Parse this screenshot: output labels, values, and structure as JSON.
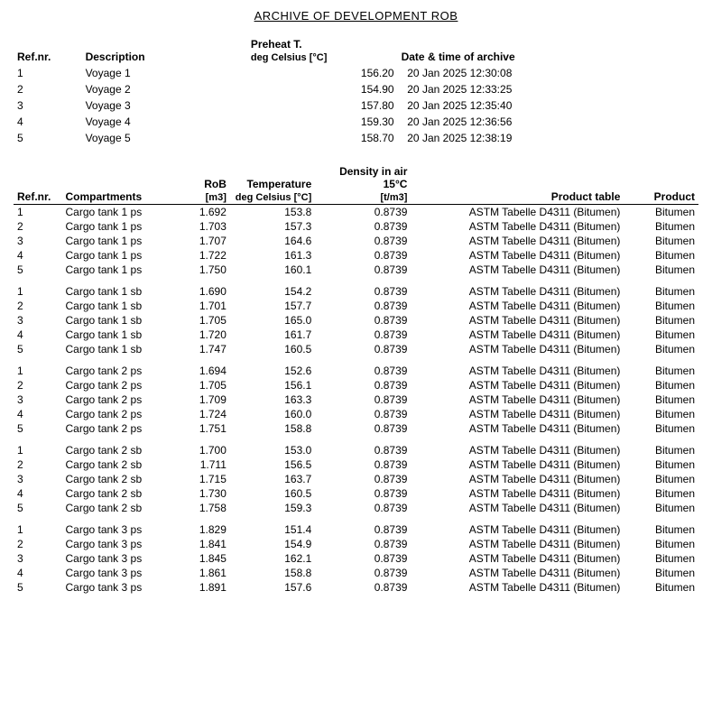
{
  "title": "ARCHIVE OF DEVELOPMENT ROB",
  "summary": {
    "headers": {
      "refnr": "Ref.nr.",
      "description": "Description",
      "preheat": "Preheat T.",
      "preheat_sub": "deg Celsius [°C]",
      "datetime": "Date & time of archive"
    },
    "rows": [
      {
        "ref": "1",
        "desc": "Voyage 1",
        "preheat": "156.20",
        "datetime": "20 Jan 2025  12:30:08"
      },
      {
        "ref": "2",
        "desc": "Voyage 2",
        "preheat": "154.90",
        "datetime": "20 Jan 2025  12:33:25"
      },
      {
        "ref": "3",
        "desc": "Voyage 3",
        "preheat": "157.80",
        "datetime": "20 Jan 2025  12:35:40"
      },
      {
        "ref": "4",
        "desc": "Voyage 4",
        "preheat": "159.30",
        "datetime": "20 Jan 2025  12:36:56"
      },
      {
        "ref": "5",
        "desc": "Voyage 5",
        "preheat": "158.70",
        "datetime": "20 Jan 2025  12:38:19"
      }
    ]
  },
  "detail": {
    "headers": {
      "refnr": "Ref.nr.",
      "compartments": "Compartments",
      "rob": "RoB",
      "rob_sub": "[m3]",
      "temperature": "Temperature",
      "temperature_sub": "deg Celsius [°C]",
      "density": "Density in air 15°C",
      "density_sub": "[t/m3]",
      "product_table": "Product table",
      "product": "Product"
    },
    "groups": [
      {
        "rows": [
          {
            "ref": "1",
            "comp": "Cargo tank 1 ps",
            "rob": "1.692",
            "temp": "153.8",
            "dens": "0.8739",
            "prod_table": "ASTM Tabelle D4311 (Bitumen)",
            "product": "Bitumen"
          },
          {
            "ref": "2",
            "comp": "Cargo tank 1 ps",
            "rob": "1.703",
            "temp": "157.3",
            "dens": "0.8739",
            "prod_table": "ASTM Tabelle D4311 (Bitumen)",
            "product": "Bitumen"
          },
          {
            "ref": "3",
            "comp": "Cargo tank 1 ps",
            "rob": "1.707",
            "temp": "164.6",
            "dens": "0.8739",
            "prod_table": "ASTM Tabelle D4311 (Bitumen)",
            "product": "Bitumen"
          },
          {
            "ref": "4",
            "comp": "Cargo tank 1 ps",
            "rob": "1.722",
            "temp": "161.3",
            "dens": "0.8739",
            "prod_table": "ASTM Tabelle D4311 (Bitumen)",
            "product": "Bitumen"
          },
          {
            "ref": "5",
            "comp": "Cargo tank 1 ps",
            "rob": "1.750",
            "temp": "160.1",
            "dens": "0.8739",
            "prod_table": "ASTM Tabelle D4311 (Bitumen)",
            "product": "Bitumen"
          }
        ]
      },
      {
        "rows": [
          {
            "ref": "1",
            "comp": "Cargo tank 1 sb",
            "rob": "1.690",
            "temp": "154.2",
            "dens": "0.8739",
            "prod_table": "ASTM Tabelle D4311 (Bitumen)",
            "product": "Bitumen"
          },
          {
            "ref": "2",
            "comp": "Cargo tank 1 sb",
            "rob": "1.701",
            "temp": "157.7",
            "dens": "0.8739",
            "prod_table": "ASTM Tabelle D4311 (Bitumen)",
            "product": "Bitumen"
          },
          {
            "ref": "3",
            "comp": "Cargo tank 1 sb",
            "rob": "1.705",
            "temp": "165.0",
            "dens": "0.8739",
            "prod_table": "ASTM Tabelle D4311 (Bitumen)",
            "product": "Bitumen"
          },
          {
            "ref": "4",
            "comp": "Cargo tank 1 sb",
            "rob": "1.720",
            "temp": "161.7",
            "dens": "0.8739",
            "prod_table": "ASTM Tabelle D4311 (Bitumen)",
            "product": "Bitumen"
          },
          {
            "ref": "5",
            "comp": "Cargo tank 1 sb",
            "rob": "1.747",
            "temp": "160.5",
            "dens": "0.8739",
            "prod_table": "ASTM Tabelle D4311 (Bitumen)",
            "product": "Bitumen"
          }
        ]
      },
      {
        "rows": [
          {
            "ref": "1",
            "comp": "Cargo tank 2 ps",
            "rob": "1.694",
            "temp": "152.6",
            "dens": "0.8739",
            "prod_table": "ASTM Tabelle D4311 (Bitumen)",
            "product": "Bitumen"
          },
          {
            "ref": "2",
            "comp": "Cargo tank 2 ps",
            "rob": "1.705",
            "temp": "156.1",
            "dens": "0.8739",
            "prod_table": "ASTM Tabelle D4311 (Bitumen)",
            "product": "Bitumen"
          },
          {
            "ref": "3",
            "comp": "Cargo tank 2 ps",
            "rob": "1.709",
            "temp": "163.3",
            "dens": "0.8739",
            "prod_table": "ASTM Tabelle D4311 (Bitumen)",
            "product": "Bitumen"
          },
          {
            "ref": "4",
            "comp": "Cargo tank 2 ps",
            "rob": "1.724",
            "temp": "160.0",
            "dens": "0.8739",
            "prod_table": "ASTM Tabelle D4311 (Bitumen)",
            "product": "Bitumen"
          },
          {
            "ref": "5",
            "comp": "Cargo tank 2 ps",
            "rob": "1.751",
            "temp": "158.8",
            "dens": "0.8739",
            "prod_table": "ASTM Tabelle D4311 (Bitumen)",
            "product": "Bitumen"
          }
        ]
      },
      {
        "rows": [
          {
            "ref": "1",
            "comp": "Cargo tank 2 sb",
            "rob": "1.700",
            "temp": "153.0",
            "dens": "0.8739",
            "prod_table": "ASTM Tabelle D4311 (Bitumen)",
            "product": "Bitumen"
          },
          {
            "ref": "2",
            "comp": "Cargo tank 2 sb",
            "rob": "1.711",
            "temp": "156.5",
            "dens": "0.8739",
            "prod_table": "ASTM Tabelle D4311 (Bitumen)",
            "product": "Bitumen"
          },
          {
            "ref": "3",
            "comp": "Cargo tank 2 sb",
            "rob": "1.715",
            "temp": "163.7",
            "dens": "0.8739",
            "prod_table": "ASTM Tabelle D4311 (Bitumen)",
            "product": "Bitumen"
          },
          {
            "ref": "4",
            "comp": "Cargo tank 2 sb",
            "rob": "1.730",
            "temp": "160.5",
            "dens": "0.8739",
            "prod_table": "ASTM Tabelle D4311 (Bitumen)",
            "product": "Bitumen"
          },
          {
            "ref": "5",
            "comp": "Cargo tank 2 sb",
            "rob": "1.758",
            "temp": "159.3",
            "dens": "0.8739",
            "prod_table": "ASTM Tabelle D4311 (Bitumen)",
            "product": "Bitumen"
          }
        ]
      },
      {
        "rows": [
          {
            "ref": "1",
            "comp": "Cargo tank 3 ps",
            "rob": "1.829",
            "temp": "151.4",
            "dens": "0.8739",
            "prod_table": "ASTM Tabelle D4311 (Bitumen)",
            "product": "Bitumen"
          },
          {
            "ref": "2",
            "comp": "Cargo tank 3 ps",
            "rob": "1.841",
            "temp": "154.9",
            "dens": "0.8739",
            "prod_table": "ASTM Tabelle D4311 (Bitumen)",
            "product": "Bitumen"
          },
          {
            "ref": "3",
            "comp": "Cargo tank 3 ps",
            "rob": "1.845",
            "temp": "162.1",
            "dens": "0.8739",
            "prod_table": "ASTM Tabelle D4311 (Bitumen)",
            "product": "Bitumen"
          },
          {
            "ref": "4",
            "comp": "Cargo tank 3 ps",
            "rob": "1.861",
            "temp": "158.8",
            "dens": "0.8739",
            "prod_table": "ASTM Tabelle D4311 (Bitumen)",
            "product": "Bitumen"
          },
          {
            "ref": "5",
            "comp": "Cargo tank 3 ps",
            "rob": "1.891",
            "temp": "157.6",
            "dens": "0.8739",
            "prod_table": "ASTM Tabelle D4311 (Bitumen)",
            "product": "Bitumen"
          }
        ]
      }
    ]
  }
}
